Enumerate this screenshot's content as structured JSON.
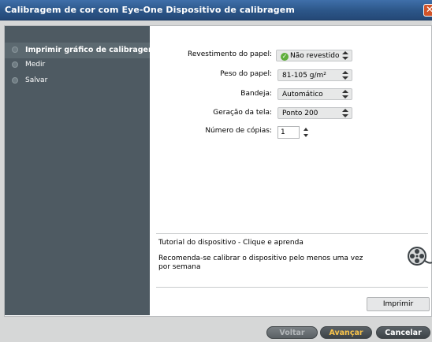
{
  "window": {
    "title": "Calibragem de cor com Eye-One Dispositivo de calibragem",
    "close_label": "✕"
  },
  "sidebar": {
    "items": [
      {
        "label": "Imprimir gráfico de calibragem",
        "active": true
      },
      {
        "label": "Medir",
        "active": false
      },
      {
        "label": "Salvar",
        "active": false
      }
    ]
  },
  "form": {
    "coating": {
      "label": "Revestimento do papel:",
      "value": "Não revestido",
      "check_icon": "✓"
    },
    "weight": {
      "label": "Peso do papel:",
      "value": "81-105 g/m²"
    },
    "tray": {
      "label": "Bandeja:",
      "value": "Automático"
    },
    "screening": {
      "label": "Geração da tela:",
      "value": "Ponto 200"
    },
    "copies": {
      "label": "Número de cópias:",
      "value": "1"
    }
  },
  "tutorial": {
    "link_text": "Tutorial do dispositivo - Clique e aprenda",
    "recommendation": "Recomenda-se calibrar o dispositivo pelo menos uma vez por semana"
  },
  "actions": {
    "print_label": "Imprimir"
  },
  "footer": {
    "back_label": "Voltar",
    "next_label": "Avançar",
    "cancel_label": "Cancelar"
  },
  "colors": {
    "titlebar": "#2c5688",
    "sidebar": "#4e5a62",
    "next_text": "#f8c34a",
    "close": "#d2542a"
  }
}
